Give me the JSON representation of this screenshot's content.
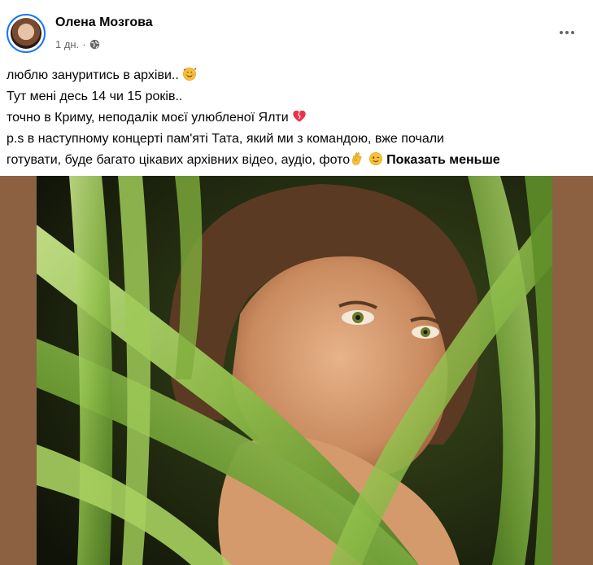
{
  "author": {
    "name": "Олена Мозгова",
    "time": "1 дн.",
    "separator": "·",
    "privacy_icon": "globe-icon"
  },
  "post": {
    "lines": [
      "люблю зануритись в архіви..",
      "Тут мені десь 14 чи 15 років..",
      "точно в Криму, неподалік моєї улюбленої Ялти",
      "p.s в наступному концерті пам'яті  Тата, який ми з командою, вже почали",
      "готувати, буде багато цікавих архівних відео, аудіо, фото"
    ],
    "show_less": "Показать меньше",
    "emojis": [
      "smiling-face-with-hearts-icon",
      "heart-icon",
      "ok-hand-icon",
      "winking-face-icon"
    ]
  },
  "colors": {
    "accent": "#1877f2",
    "secondary_text": "#65676b",
    "media_background": "#8b6142"
  }
}
